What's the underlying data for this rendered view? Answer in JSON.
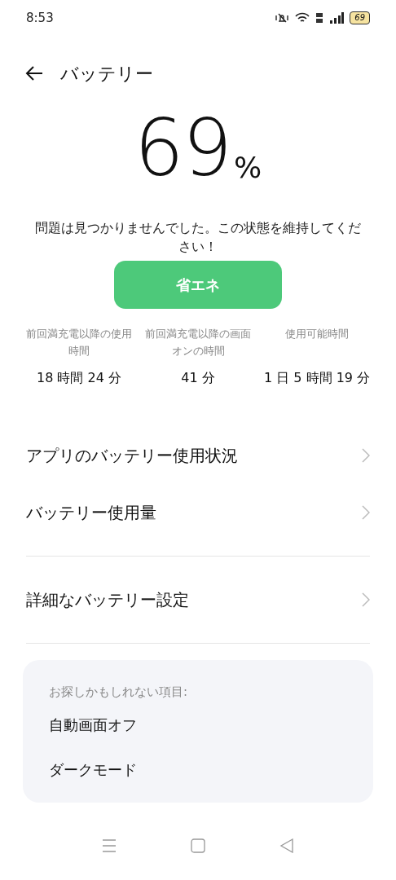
{
  "status_bar": {
    "time": "8:53",
    "battery": "69"
  },
  "header": {
    "title": "バッテリー"
  },
  "battery": {
    "percent": "69",
    "unit": "%"
  },
  "message": "問題は見つかりませんでした。この状態を維持してください！",
  "power_saving_button": "省エネ",
  "stats": [
    {
      "label": "前回満充電以降の使用時間",
      "value": "18 時間 24 分"
    },
    {
      "label": "前回満充電以降の画面オンの時間",
      "value": "41 分"
    },
    {
      "label": "使用可能時間",
      "value": "1 日 5 時間 19 分"
    }
  ],
  "menu_groups": [
    [
      {
        "label": "アプリのバッテリー使用状況"
      },
      {
        "label": "バッテリー使用量"
      }
    ],
    [
      {
        "label": "詳細なバッテリー設定"
      }
    ]
  ],
  "suggestions": {
    "title": "お探しかもしれない項目:",
    "items": [
      "自動画面オフ",
      "ダークモード"
    ]
  }
}
